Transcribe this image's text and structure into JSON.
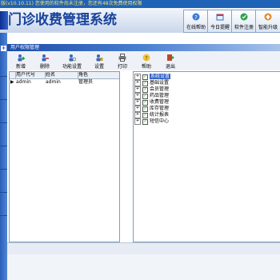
{
  "app": {
    "title_bar_text": "版(v10.10.11)  您使用的软件尚未注册，您还有48次免费使用权限",
    "logo_text": "门诊收费管理系统"
  },
  "header_buttons": [
    {
      "label": "在线帮助",
      "icon": "help-icon"
    },
    {
      "label": "今日提醒",
      "icon": "reminder-icon"
    },
    {
      "label": "软件注册",
      "icon": "register-icon"
    },
    {
      "label": "智能升级",
      "icon": "upgrade-icon"
    }
  ],
  "sidebar": {
    "toggle_symbol": "+"
  },
  "panel": {
    "title": "用户权限管理"
  },
  "toolbar": {
    "items": [
      {
        "label": "新增",
        "icon": "add-user-icon"
      },
      {
        "label": "删除",
        "icon": "delete-user-icon"
      },
      {
        "label": "功能设置",
        "icon": "function-settings-icon"
      },
      {
        "label": "设置",
        "icon": "settings-icon"
      },
      {
        "label": "打印",
        "icon": "print-icon"
      },
      {
        "label": "帮助",
        "icon": "help-icon"
      },
      {
        "label": "退出",
        "icon": "exit-icon"
      }
    ]
  },
  "user_table": {
    "columns": [
      "用户代号",
      "姓名",
      "角色"
    ],
    "row_indicator": "▶",
    "rows": [
      [
        "admin",
        "admin",
        "管理员"
      ]
    ]
  },
  "permission_tree": {
    "expander_symbol": "+",
    "check_symbol": "✓",
    "items": [
      {
        "label": "系统设置",
        "selected": true
      },
      {
        "label": "基础设置",
        "selected": false
      },
      {
        "label": "会员管理",
        "selected": false
      },
      {
        "label": "药品管理",
        "selected": false
      },
      {
        "label": "收费管理",
        "selected": false
      },
      {
        "label": "库存管理",
        "selected": false
      },
      {
        "label": "统计报表",
        "selected": false
      },
      {
        "label": "短信中心",
        "selected": false
      }
    ]
  },
  "colors": {
    "title_bar": "#1f63b6",
    "logo_text": "#17419a",
    "panel_header": "#1c4ca8",
    "selection": "#2d5fc6"
  }
}
